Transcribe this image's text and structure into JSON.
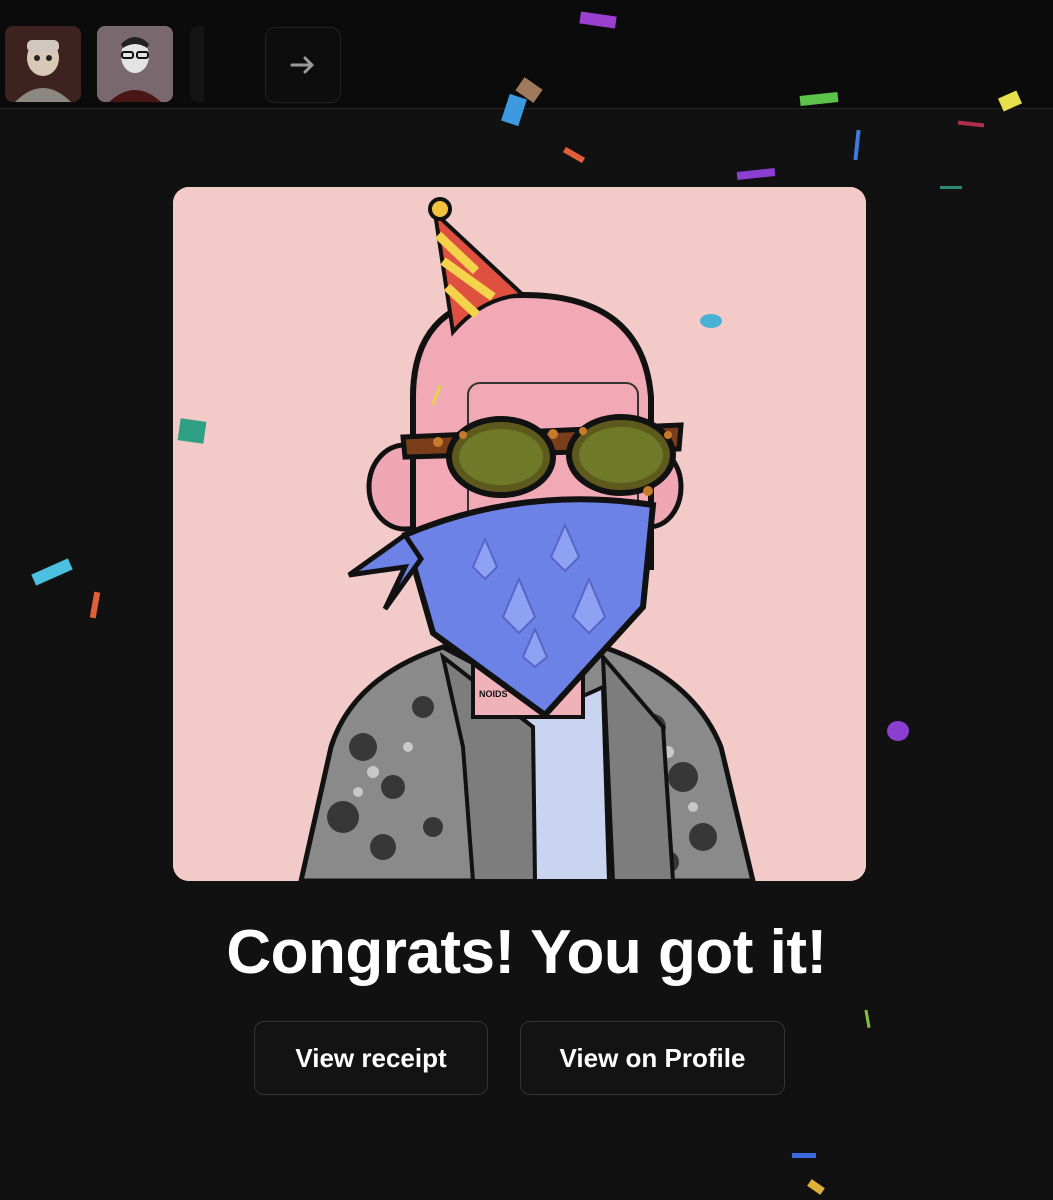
{
  "top_strip": {
    "arrow_icon": "arrow-right-icon",
    "thumbnails": [
      "collectible-thumbnail-1",
      "collectible-thumbnail-2",
      "collectible-thumbnail-3"
    ]
  },
  "nft": {
    "image_name": "pink-character-party-hat-bandana",
    "tag_text": "NOIDS",
    "background_color": "#f2cbc8"
  },
  "headline": "Congrats! You got it!",
  "actions": {
    "view_receipt": "View receipt",
    "view_on_profile": "View on Profile"
  },
  "colors": {
    "page_background": "#111111",
    "button_border": "#333338",
    "text": "#ffffff"
  }
}
